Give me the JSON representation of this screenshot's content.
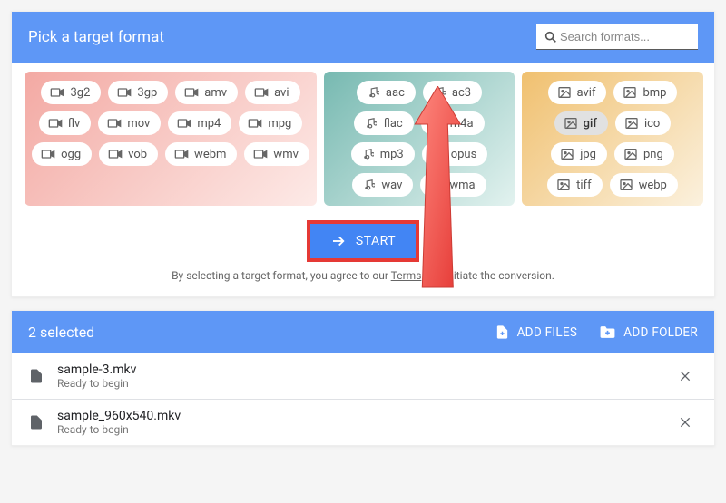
{
  "header": {
    "title": "Pick a target format",
    "search_placeholder": "Search formats..."
  },
  "formats": {
    "video": [
      "3g2",
      "3gp",
      "amv",
      "avi",
      "flv",
      "mov",
      "mp4",
      "mpg",
      "ogg",
      "vob",
      "webm",
      "wmv"
    ],
    "audio": [
      "aac",
      "ac3",
      "flac",
      "m4a",
      "mp3",
      "opus",
      "wav",
      "wma"
    ],
    "image": [
      "avif",
      "bmp",
      "gif",
      "ico",
      "jpg",
      "png",
      "tiff",
      "webp"
    ],
    "selected": "gif"
  },
  "start_label": "START",
  "terms": {
    "pre": "By selecting a target format, you agree to our ",
    "link": "Terms",
    "post": " and initiate the conversion."
  },
  "selection": {
    "title": "2 selected",
    "add_files": "ADD FILES",
    "add_folder": "ADD FOLDER",
    "files": [
      {
        "name": "sample-3.mkv",
        "status": "Ready to begin"
      },
      {
        "name": "sample_960x540.mkv",
        "status": "Ready to begin"
      }
    ]
  }
}
